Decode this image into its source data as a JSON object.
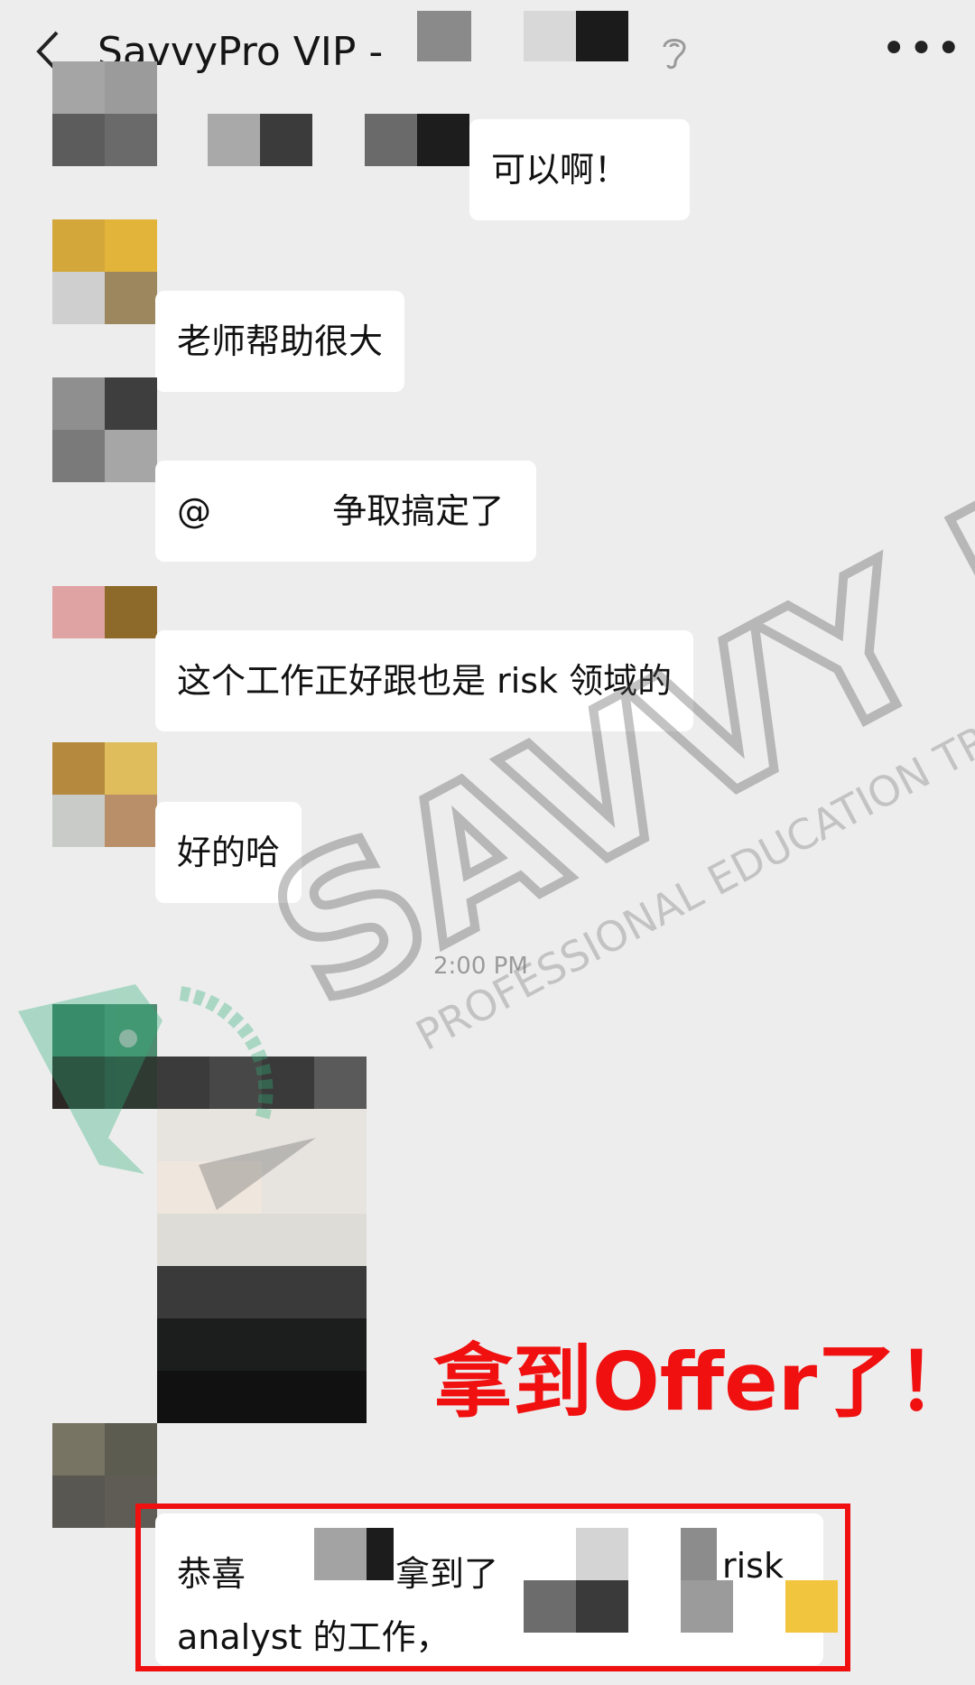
{
  "header": {
    "back_icon": "chevron-left-icon",
    "title": "SavvyPro VIP -",
    "more_label": "•••"
  },
  "messages": [
    {
      "text": "可以啊！"
    },
    {
      "text": "老师帮助很大"
    },
    {
      "mention": "@",
      "text": "争取搞定了"
    },
    {
      "text": "这个工作正好跟也是 risk 领域的"
    },
    {
      "text": "好的哈"
    },
    {
      "line1_a": "恭喜",
      "line1_b": "拿到了",
      "line1_c": "risk",
      "line2": "analyst 的工作，"
    }
  ],
  "timestamp": "2:00 PM",
  "watermark": {
    "brand": "SAVVY PRO",
    "tagline": "PROFESSIONAL EDUCATION TRAINING"
  },
  "annotation": "拿到Offer了！",
  "colors": {
    "background": "#ededed",
    "bubble": "#ffffff",
    "highlight": "#f01010",
    "watermark_green": "#2fb07a",
    "watermark_gray": "#666666"
  }
}
